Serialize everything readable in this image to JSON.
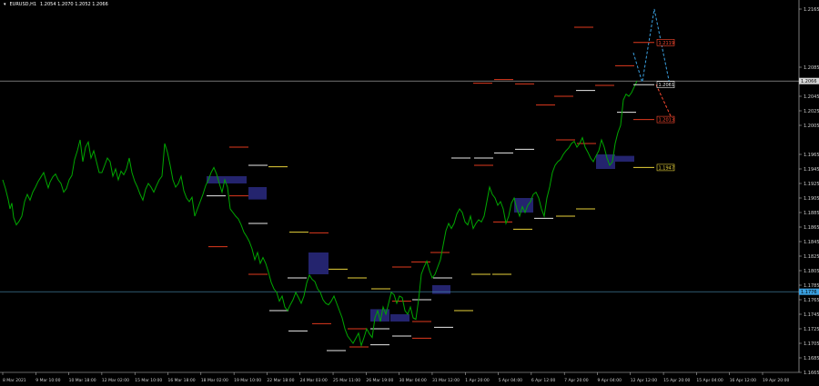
{
  "header": {
    "symbol": "EURUSD,H1",
    "ohlc": "1.2054 1.2070 1.2052 1.2066"
  },
  "chart_data": {
    "type": "line",
    "ylim": [
      1.1665,
      1.217
    ],
    "grid": false,
    "colors": {
      "price": "#00a800",
      "axis": "#cfcfcf",
      "red_level": "#e03a1e",
      "white_level": "#e8e8e8",
      "yellow_level": "#e8d23a",
      "zone": "#24246e",
      "bid_line": "#b8b8b8",
      "blue_line": "#4a8fb5",
      "label_red": "#ff4a30",
      "label_yellow": "#e8d23a",
      "label_blue": "#3aa0e0"
    },
    "y_ticks": [
      "1.2165",
      "1.2085",
      "1.2045",
      "1.2025",
      "1.2005",
      "1.1965",
      "1.1945",
      "1.1925",
      "1.1905",
      "1.1885",
      "1.1865",
      "1.1845",
      "1.1825",
      "1.1805",
      "1.1785",
      "1.1765",
      "1.1745",
      "1.1725",
      "1.1705",
      "1.1685",
      "1.1665"
    ],
    "x_ticks": [
      "8 Mar 2021",
      "9 Mar 10:00",
      "10 Mar 18:00",
      "12 Mar 02:00",
      "15 Mar 10:00",
      "16 Mar 18:00",
      "18 Mar 02:00",
      "19 Mar 10:00",
      "22 Mar 18:00",
      "24 Mar 03:00",
      "25 Mar 11:00",
      "26 Mar 19:00",
      "30 Mar 04:00",
      "31 Mar 12:00",
      "1 Apr 20:00",
      "5 Apr 04:00",
      "6 Apr 12:00",
      "7 Apr 20:00",
      "9 Apr 04:00",
      "12 Apr 12:00",
      "15 Apr 20:00",
      "15 Apr 04:00",
      "16 Apr 12:00",
      "19 Apr 20:00"
    ],
    "price_label": "1.2066",
    "blue_level_label": "1.1776",
    "box_labels": [
      {
        "text": "1.2119",
        "price": 1.2119,
        "color": "red"
      },
      {
        "text": "1.2061",
        "price": 1.2061,
        "color": "white"
      },
      {
        "text": "1.2013",
        "price": 1.2013,
        "color": "red"
      },
      {
        "text": "1.1947",
        "price": 1.1947,
        "color": "yellow"
      }
    ],
    "series": [
      {
        "x_index": [
          0,
          3,
          6,
          8,
          10,
          12,
          15,
          18,
          21,
          24,
          27,
          30,
          33,
          36,
          39,
          42,
          45,
          48,
          50,
          52,
          55,
          58,
          61,
          64,
          67,
          70,
          73,
          76,
          79,
          82,
          85,
          88,
          91,
          94,
          97,
          100,
          103,
          106,
          109,
          112,
          115,
          118,
          121,
          124,
          127,
          130,
          133,
          136,
          139,
          142,
          145,
          148,
          151,
          154,
          157,
          160,
          163,
          166,
          169,
          172,
          175,
          178,
          181,
          184,
          187,
          190,
          193,
          196,
          199,
          202,
          205,
          208,
          211,
          214,
          217,
          220,
          223,
          226,
          229,
          232,
          235,
          238,
          241,
          244,
          247,
          250,
          253,
          256,
          259,
          262,
          265,
          268,
          271,
          274,
          277,
          280,
          283,
          286,
          289,
          292,
          295,
          298,
          301,
          304,
          307,
          310,
          313,
          316,
          319,
          322,
          325,
          328,
          331,
          334,
          337,
          340,
          343,
          346,
          349,
          352,
          355,
          358,
          361,
          364,
          367,
          370,
          373,
          376,
          379,
          382,
          385,
          388,
          391,
          394,
          397,
          400,
          403,
          406,
          409,
          412,
          415,
          418,
          421,
          424,
          427,
          430,
          433,
          436,
          439,
          442,
          445,
          448,
          451,
          454,
          457,
          460,
          463,
          466,
          469,
          472,
          475,
          478,
          481,
          484,
          487,
          490,
          493,
          496,
          499,
          502,
          505,
          508,
          511,
          514,
          517,
          520,
          523,
          526,
          529,
          532,
          535,
          538,
          541,
          544,
          547,
          550,
          553,
          556,
          559,
          562,
          565,
          568,
          571,
          574,
          577,
          580,
          583,
          586,
          589,
          592,
          595,
          598,
          601,
          604,
          607,
          610,
          613,
          616,
          619,
          622,
          625,
          628,
          631,
          634,
          637,
          640,
          643,
          646,
          649,
          652,
          655,
          658,
          661,
          664,
          667,
          670,
          673,
          676,
          679,
          682,
          685,
          688,
          691,
          694,
          697,
          700,
          703
        ],
        "values": [
          1.193,
          1.1918,
          1.1903,
          1.189,
          1.1898,
          1.1878,
          1.1868,
          1.1873,
          1.188,
          1.19,
          1.191,
          1.1902,
          1.1913,
          1.192,
          1.1928,
          1.1934,
          1.194,
          1.1927,
          1.1919,
          1.1927,
          1.1934,
          1.1938,
          1.193,
          1.1925,
          1.1913,
          1.1918,
          1.193,
          1.1936,
          1.1958,
          1.197,
          1.1985,
          1.1955,
          1.1975,
          1.1982,
          1.196,
          1.197,
          1.1955,
          1.194,
          1.194,
          1.195,
          1.196,
          1.1955,
          1.1935,
          1.1945,
          1.193,
          1.1942,
          1.1937,
          1.1945,
          1.196,
          1.194,
          1.1928,
          1.192,
          1.191,
          1.1902,
          1.1917,
          1.1925,
          1.192,
          1.1913,
          1.1922,
          1.193,
          1.1935,
          1.198,
          1.1968,
          1.195,
          1.193,
          1.192,
          1.1925,
          1.1935,
          1.1915,
          1.1905,
          1.19,
          1.1906,
          1.188,
          1.189,
          1.19,
          1.191,
          1.1922,
          1.193,
          1.194,
          1.1947,
          1.1938,
          1.1925,
          1.1913,
          1.193,
          1.192,
          1.189,
          1.1885,
          1.188,
          1.1876,
          1.1868,
          1.1858,
          1.1852,
          1.1845,
          1.1835,
          1.182,
          1.183,
          1.1815,
          1.1823,
          1.1815,
          1.1803,
          1.1789,
          1.178,
          1.1775,
          1.1763,
          1.177,
          1.1755,
          1.175,
          1.1758,
          1.1765,
          1.1775,
          1.1768,
          1.176,
          1.177,
          1.1788,
          1.1799,
          1.1793,
          1.179,
          1.178,
          1.1775,
          1.1765,
          1.176,
          1.1758,
          1.1763,
          1.177,
          1.176,
          1.175,
          1.174,
          1.1725,
          1.1715,
          1.171,
          1.1705,
          1.1712,
          1.1719,
          1.1702,
          1.1713,
          1.1725,
          1.1718,
          1.1713,
          1.174,
          1.175,
          1.1735,
          1.1755,
          1.1745,
          1.176,
          1.1775,
          1.1772,
          1.176,
          1.177,
          1.1768,
          1.175,
          1.1745,
          1.1755,
          1.174,
          1.1738,
          1.1765,
          1.18,
          1.181,
          1.1818,
          1.1805,
          1.1795,
          1.18,
          1.181,
          1.182,
          1.184,
          1.186,
          1.187,
          1.1863,
          1.187,
          1.1883,
          1.189,
          1.1885,
          1.1872,
          1.1868,
          1.188,
          1.1863,
          1.187,
          1.1875,
          1.1872,
          1.188,
          1.19,
          1.192,
          1.191,
          1.1905,
          1.1895,
          1.19,
          1.189,
          1.187,
          1.188,
          1.1898,
          1.1905,
          1.189,
          1.188,
          1.1893,
          1.1885,
          1.1895,
          1.19,
          1.191,
          1.1913,
          1.1905,
          1.189,
          1.188,
          1.1905,
          1.192,
          1.194,
          1.195,
          1.1955,
          1.1958,
          1.1965,
          1.197,
          1.1974,
          1.198,
          1.1983,
          1.1975,
          1.198,
          1.1988,
          1.1975,
          1.1968,
          1.196,
          1.1955,
          1.1963,
          1.197,
          1.1985,
          1.1975,
          1.196,
          1.195,
          1.1955,
          1.198,
          1.1995,
          1.2005,
          1.204,
          1.2048,
          1.2045,
          1.205,
          1.2058,
          1.2066
        ]
      }
    ]
  }
}
